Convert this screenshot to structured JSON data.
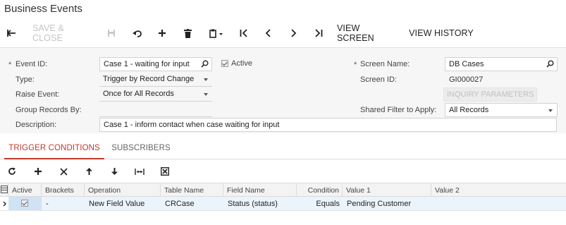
{
  "page": {
    "title": "Business Events"
  },
  "toolbar": {
    "back_icon": "back-arrow-icon",
    "save_close_label": "SAVE & CLOSE",
    "save_icon": "save-icon",
    "undo_icon": "undo-icon",
    "add_icon": "plus-icon",
    "delete_icon": "trash-icon",
    "clipboard_icon": "clipboard-icon",
    "first_icon": "first-record-icon",
    "prev_icon": "previous-record-icon",
    "next_icon": "next-record-icon",
    "last_icon": "last-record-icon",
    "view_screen_label": "VIEW SCREEN",
    "view_history_label": "VIEW HISTORY"
  },
  "form": {
    "required_mark": "*",
    "event_id_label": "Event ID:",
    "event_id_value": "Case 1 - waiting for input",
    "active_label": "Active",
    "active_checked": true,
    "type_label": "Type:",
    "type_value": "Trigger by Record Change",
    "raise_event_label": "Raise Event:",
    "raise_event_value": "Once for All Records",
    "group_records_label": "Group Records By:",
    "group_records_value": "",
    "description_label": "Description:",
    "description_value": "Case 1 - inform contact when case waiting for input",
    "screen_name_label": "Screen Name:",
    "screen_name_value": "DB Cases",
    "screen_id_label": "Screen ID:",
    "screen_id_value": "GI000027",
    "inquiry_params_label": "INQUIRY PARAMETERS",
    "shared_filter_label": "Shared Filter to Apply:",
    "shared_filter_value": "All Records"
  },
  "tabs": [
    {
      "label": "TRIGGER CONDITIONS",
      "active": true
    },
    {
      "label": "SUBSCRIBERS",
      "active": false
    }
  ],
  "grid_toolbar": {
    "refresh_icon": "refresh-icon",
    "add_icon": "plus-icon",
    "delete_icon": "close-icon",
    "up_icon": "arrow-up-icon",
    "down_icon": "arrow-down-icon",
    "fit_icon": "fit-columns-icon",
    "export_icon": "export-excel-icon"
  },
  "grid": {
    "columns": [
      "Active",
      "Brackets",
      "Operation",
      "Table Name",
      "Field Name",
      "Condition",
      "Value 1",
      "Value 2"
    ],
    "rows": [
      {
        "active": true,
        "brackets": "-",
        "operation": "New Field Value",
        "table_name": "CRCase",
        "field_name": "Status (status)",
        "condition": "Equals",
        "value1": "Pending Customer",
        "value2": ""
      }
    ]
  },
  "colors": {
    "accent": "#c0392b",
    "row_highlight": "#ecf4fb"
  }
}
